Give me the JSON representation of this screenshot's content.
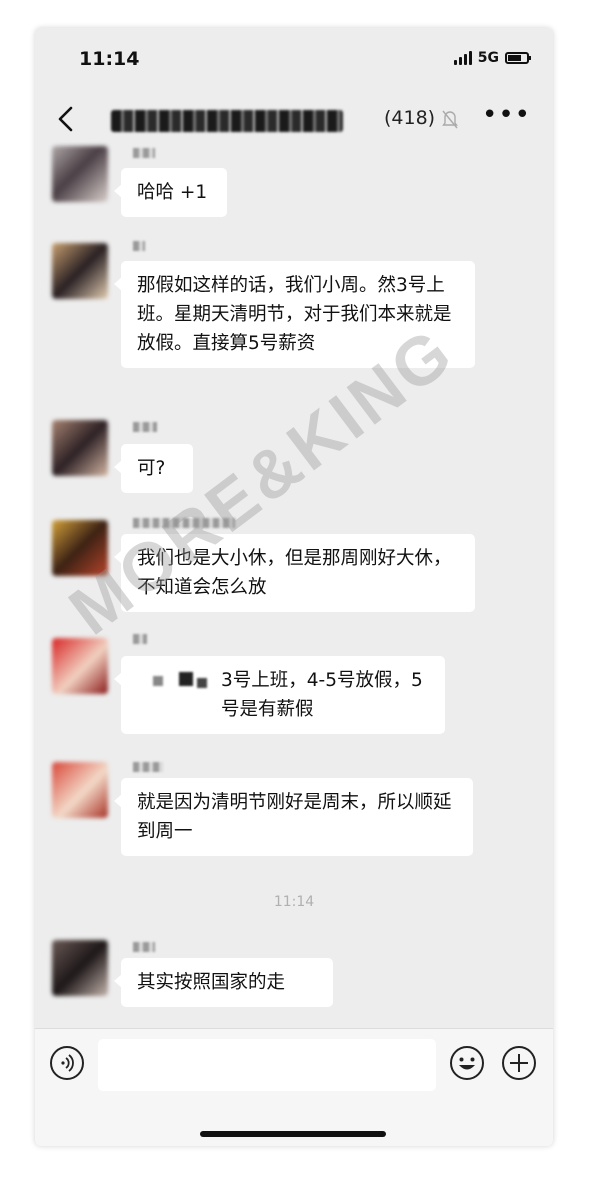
{
  "status_bar": {
    "time": "11:14",
    "network": "5G"
  },
  "nav": {
    "member_count": "(418)",
    "more_label": "•••"
  },
  "messages": [
    {
      "text": "哈哈 +1",
      "avatar_colors": [
        "#b0a8a8",
        "#4a3f45",
        "#d9d0cc"
      ]
    },
    {
      "text": "那假如这样的话，我们小周。然3号上班。星期天清明节，对于我们本来就是放假。直接算5号薪资",
      "avatar_colors": [
        "#c9a070",
        "#2a2124",
        "#e3cdb2"
      ]
    },
    {
      "text": "可?",
      "avatar_colors": [
        "#a88472",
        "#2e2226",
        "#d6b6a4"
      ]
    },
    {
      "text": "我们也是大小休，但是那周刚好大休，不知道会怎么放",
      "avatar_colors": [
        "#d4a23a",
        "#3d2214",
        "#b8452c"
      ]
    },
    {
      "text": "3号上班，4-5号放假，5号是有薪假",
      "avatar_colors": [
        "#d82525",
        "#f1d0c0",
        "#8a1a1a"
      ]
    },
    {
      "text": "就是因为清明节刚好是周末，所以顺延到周一",
      "avatar_colors": [
        "#d8483a",
        "#f3d9c8",
        "#a83226"
      ]
    },
    {
      "text": "其实按照国家的走",
      "avatar_colors": [
        "#6a5a55",
        "#1e1819",
        "#c4b4ac"
      ]
    }
  ],
  "time_divider": "11:14",
  "input": {
    "placeholder": ""
  },
  "watermark": "MORE&KING"
}
